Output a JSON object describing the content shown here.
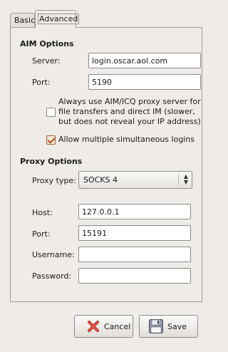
{
  "tabs": {
    "basic": "Basic",
    "advanced": "Advanced"
  },
  "aim": {
    "heading": "AIM Options",
    "server_label": "Server:",
    "server_value": "login.oscar.aol.com",
    "port_label": "Port:",
    "port_value": "5190",
    "proxy_check_line1": "Always use AIM/ICQ proxy server for",
    "proxy_check_line2": "file transfers and direct IM (slower,",
    "proxy_check_line3": "but does not reveal your IP address)",
    "proxy_check_checked": false,
    "multi_login_label": "Allow multiple simultaneous logins",
    "multi_login_checked": true
  },
  "proxy": {
    "heading": "Proxy Options",
    "type_label": "Proxy type:",
    "type_value": "SOCKS 4",
    "host_label": "Host:",
    "host_value": "127.0.0.1",
    "port_label": "Port:",
    "port_value": "15191",
    "username_label": "Username:",
    "username_value": "",
    "password_label": "Password:",
    "password_value": ""
  },
  "buttons": {
    "cancel": "Cancel",
    "save": "Save"
  },
  "icons": {
    "cancel": "red-x-icon",
    "save": "floppy-disk-icon"
  }
}
